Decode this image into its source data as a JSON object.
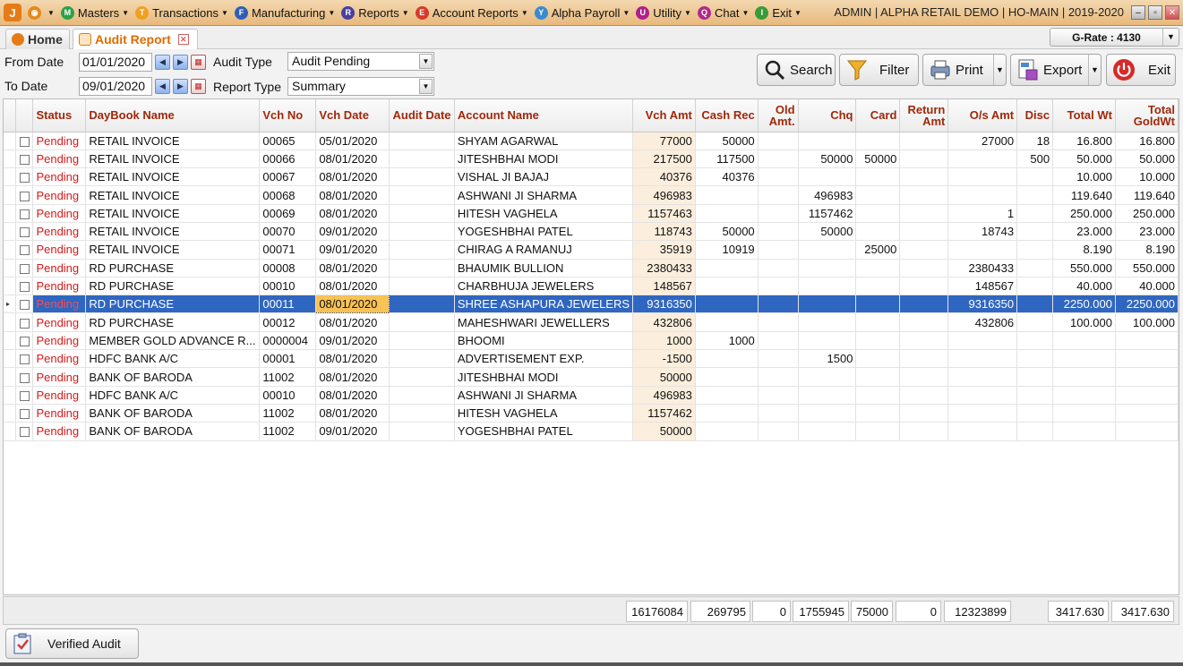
{
  "app": {
    "logo": "J",
    "title_info": "ADMIN | ALPHA RETAIL DEMO | HO-MAIN | 2019-2020",
    "menu": [
      {
        "label": "",
        "icon": "settings-icon",
        "color": "#e58a1a",
        "glyph": "◉"
      },
      {
        "label": "Masters",
        "icon": "masters-icon",
        "color": "#2aa14a",
        "glyph": "M"
      },
      {
        "label": "Transactions",
        "icon": "transactions-icon",
        "color": "#f0a020",
        "glyph": "T"
      },
      {
        "label": "Manufacturing",
        "icon": "manufacturing-icon",
        "color": "#2d5fb8",
        "glyph": "F"
      },
      {
        "label": "Reports",
        "icon": "reports-icon",
        "color": "#4a3fa0",
        "glyph": "R"
      },
      {
        "label": "Account Reports",
        "icon": "account-reports-icon",
        "color": "#d83a2a",
        "glyph": "E"
      },
      {
        "label": "Alpha Payroll",
        "icon": "payroll-icon",
        "color": "#3a8ad0",
        "glyph": "Y"
      },
      {
        "label": "Utility",
        "icon": "utility-icon",
        "color": "#b0208a",
        "glyph": "U"
      },
      {
        "label": "Chat",
        "icon": "chat-icon",
        "color": "#b02a8a",
        "glyph": "Q"
      },
      {
        "label": "Exit",
        "icon": "exit-icon",
        "color": "#3a9a3a",
        "glyph": "I"
      }
    ]
  },
  "tabs": {
    "home": "Home",
    "audit": "Audit Report"
  },
  "grate": "G-Rate : 4130",
  "filters": {
    "from_label": "From Date",
    "from_value": "01/01/2020",
    "to_label": "To Date",
    "to_value": "09/01/2020",
    "audit_type_label": "Audit Type",
    "audit_type_value": "Audit Pending",
    "report_type_label": "Report Type",
    "report_type_value": "Summary"
  },
  "toolbar": {
    "search": "Search",
    "filter": "Filter",
    "print": "Print",
    "export": "Export",
    "exit": "Exit"
  },
  "columns": [
    "Status",
    "DayBook Name",
    "Vch No",
    "Vch Date",
    "Audit Date",
    "Account Name",
    "Vch Amt",
    "Cash Rec",
    "Old Amt.",
    "Chq",
    "Card",
    "Return Amt",
    "O/s Amt",
    "Disc",
    "Total Wt",
    "Total GoldWt"
  ],
  "rows": [
    [
      "Pending",
      "RETAIL INVOICE",
      "00065",
      "05/01/2020",
      "",
      "SHYAM AGARWAL",
      "77000",
      "50000",
      "",
      "",
      "",
      "",
      "27000",
      "18",
      "16.800",
      "16.800"
    ],
    [
      "Pending",
      "RETAIL INVOICE",
      "00066",
      "08/01/2020",
      "",
      "JITESHBHAI MODI",
      "217500",
      "117500",
      "",
      "50000",
      "50000",
      "",
      "",
      "500",
      "50.000",
      "50.000"
    ],
    [
      "Pending",
      "RETAIL INVOICE",
      "00067",
      "08/01/2020",
      "",
      "VISHAL JI BAJAJ",
      "40376",
      "40376",
      "",
      "",
      "",
      "",
      "",
      "",
      "10.000",
      "10.000"
    ],
    [
      "Pending",
      "RETAIL INVOICE",
      "00068",
      "08/01/2020",
      "",
      "ASHWANI JI SHARMA",
      "496983",
      "",
      "",
      "496983",
      "",
      "",
      "",
      "",
      "119.640",
      "119.640"
    ],
    [
      "Pending",
      "RETAIL INVOICE",
      "00069",
      "08/01/2020",
      "",
      "HITESH VAGHELA",
      "1157463",
      "",
      "",
      "1157462",
      "",
      "",
      "1",
      "",
      "250.000",
      "250.000"
    ],
    [
      "Pending",
      "RETAIL INVOICE",
      "00070",
      "09/01/2020",
      "",
      "YOGESHBHAI PATEL",
      "118743",
      "50000",
      "",
      "50000",
      "",
      "",
      "18743",
      "",
      "23.000",
      "23.000"
    ],
    [
      "Pending",
      "RETAIL INVOICE",
      "00071",
      "09/01/2020",
      "",
      "CHIRAG A RAMANUJ",
      "35919",
      "10919",
      "",
      "",
      "25000",
      "",
      "",
      "",
      "8.190",
      "8.190"
    ],
    [
      "Pending",
      "RD PURCHASE",
      "00008",
      "08/01/2020",
      "",
      "BHAUMIK BULLION",
      "2380433",
      "",
      "",
      "",
      "",
      "",
      "2380433",
      "",
      "550.000",
      "550.000"
    ],
    [
      "Pending",
      "RD PURCHASE",
      "00010",
      "08/01/2020",
      "",
      "CHARBHUJA JEWELERS",
      "148567",
      "",
      "",
      "",
      "",
      "",
      "148567",
      "",
      "40.000",
      "40.000"
    ],
    [
      "Pending",
      "RD PURCHASE",
      "00011",
      "08/01/2020",
      "",
      "SHREE ASHAPURA JEWELERS",
      "9316350",
      "",
      "",
      "",
      "",
      "",
      "9316350",
      "",
      "2250.000",
      "2250.000"
    ],
    [
      "Pending",
      "RD PURCHASE",
      "00012",
      "08/01/2020",
      "",
      "MAHESHWARI JEWELLERS",
      "432806",
      "",
      "",
      "",
      "",
      "",
      "432806",
      "",
      "100.000",
      "100.000"
    ],
    [
      "Pending",
      "MEMBER GOLD ADVANCE R...",
      "0000004",
      "09/01/2020",
      "",
      "BHOOMI",
      "1000",
      "1000",
      "",
      "",
      "",
      "",
      "",
      "",
      "",
      ""
    ],
    [
      "Pending",
      "HDFC BANK A/C",
      "00001",
      "08/01/2020",
      "",
      "ADVERTISEMENT EXP.",
      "-1500",
      "",
      "",
      "1500",
      "",
      "",
      "",
      "",
      "",
      ""
    ],
    [
      "Pending",
      "BANK OF BARODA",
      "11002",
      "08/01/2020",
      "",
      "JITESHBHAI MODI",
      "50000",
      "",
      "",
      "",
      "",
      "",
      "",
      "",
      "",
      ""
    ],
    [
      "Pending",
      "HDFC BANK A/C",
      "00010",
      "08/01/2020",
      "",
      "ASHWANI JI SHARMA",
      "496983",
      "",
      "",
      "",
      "",
      "",
      "",
      "",
      "",
      ""
    ],
    [
      "Pending",
      "BANK OF BARODA",
      "11002",
      "08/01/2020",
      "",
      "HITESH VAGHELA",
      "1157462",
      "",
      "",
      "",
      "",
      "",
      "",
      "",
      "",
      ""
    ],
    [
      "Pending",
      "BANK OF BARODA",
      "11002",
      "09/01/2020",
      "",
      "YOGESHBHAI PATEL",
      "50000",
      "",
      "",
      "",
      "",
      "",
      "",
      "",
      "",
      ""
    ]
  ],
  "selected_row": 9,
  "totals": {
    "vch_amt": "16176084",
    "cash_rec": "269795",
    "old_amt": "0",
    "chq": "1755945",
    "card": "75000",
    "return_amt": "0",
    "os_amt": "12323899",
    "total_wt": "3417.630",
    "total_goldwt": "3417.630"
  },
  "footer": {
    "verified_audit": "Verified Audit"
  }
}
